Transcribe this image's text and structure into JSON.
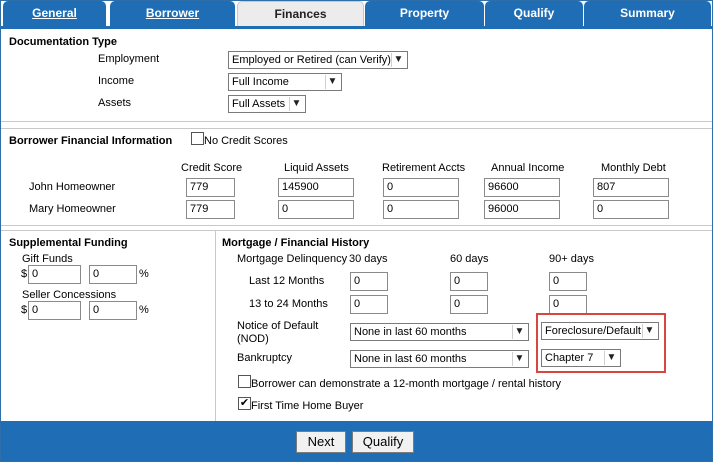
{
  "tabs": [
    "General",
    "Borrower",
    "Finances",
    "Property",
    "Qualify",
    "Summary"
  ],
  "documentation": {
    "title": "Documentation Type",
    "employment_label": "Employment",
    "employment_value": "Employed or Retired (can Verify)",
    "income_label": "Income",
    "income_value": "Full Income",
    "assets_label": "Assets",
    "assets_value": "Full Assets"
  },
  "borrower_fin": {
    "title": "Borrower Financial Information",
    "no_credit_label": "No Credit Scores",
    "columns": [
      "Credit Score",
      "Liquid Assets",
      "Retirement Accts",
      "Annual Income",
      "Monthly Debt"
    ],
    "rows": [
      {
        "name": "John Homeowner",
        "values": [
          "779",
          "145900",
          "0",
          "96600",
          "807"
        ]
      },
      {
        "name": "Mary Homeowner",
        "values": [
          "779",
          "0",
          "0",
          "96000",
          "0"
        ]
      }
    ]
  },
  "supplemental": {
    "title": "Supplemental Funding",
    "gift_label": "Gift Funds",
    "gift_amount": "0",
    "gift_pct": "0",
    "seller_label": "Seller Concessions",
    "seller_amount": "0",
    "seller_pct": "0",
    "dollar": "$",
    "percent": "%"
  },
  "mortgage": {
    "title": "Mortgage / Financial History",
    "delinquency_label": "Mortgage Delinquency",
    "col_30": "30 days",
    "col_60": "60 days",
    "col_90": "90+ days",
    "last12_label": "Last 12 Months",
    "last12": [
      "0",
      "0",
      "0"
    ],
    "m13_24_label": "13 to 24 Months",
    "m13_24": [
      "0",
      "0",
      "0"
    ],
    "nod_label_1": "Notice of Default",
    "nod_label_2": "(NOD)",
    "nod_value": "None in last 60 months",
    "nod_type": "Foreclosure/Default",
    "bankruptcy_label": "Bankruptcy",
    "bankruptcy_value": "None in last 60 months",
    "bankruptcy_type": "Chapter 7",
    "history_label": "Borrower can demonstrate a 12-month mortgage / rental history",
    "first_time_label": "First Time Home Buyer"
  },
  "buttons": {
    "next": "Next",
    "qualify": "Qualify"
  },
  "colors": {
    "brand": "#1f6db5",
    "highlight": "#d9453f"
  }
}
